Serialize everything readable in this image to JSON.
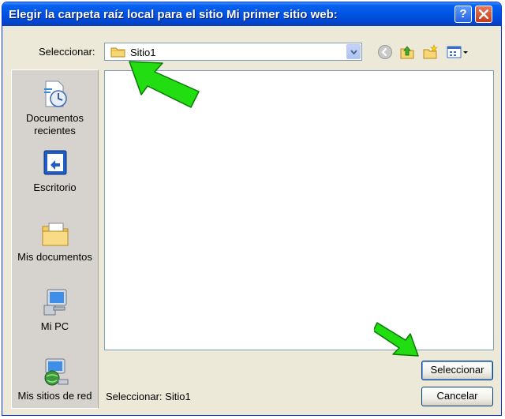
{
  "window": {
    "title": "Elegir la carpeta raíz local para el sitio Mi primer sitio web:",
    "help_label": "?"
  },
  "lookin": {
    "label": "Seleccionar:",
    "value": "Sitio1"
  },
  "toolbar": {
    "icons": [
      "back-icon",
      "up-folder-icon",
      "new-folder-icon",
      "views-menu-icon"
    ]
  },
  "places": [
    {
      "label": "Documentos recientes",
      "icon": "recent-documents-icon"
    },
    {
      "label": "Escritorio",
      "icon": "desktop-icon"
    },
    {
      "label": "Mis documentos",
      "icon": "my-documents-icon"
    },
    {
      "label": "Mi PC",
      "icon": "my-computer-icon"
    },
    {
      "label": "Mis sitios de red",
      "icon": "network-places-icon"
    }
  ],
  "status": {
    "select_text": "Seleccionar: Sitio1"
  },
  "buttons": {
    "select": "Seleccionar",
    "cancel": "Cancelar"
  },
  "colors": {
    "titlebar": "#0055e5",
    "dialog_bg": "#ece9d8",
    "annotation_arrow": "#22dd11"
  }
}
